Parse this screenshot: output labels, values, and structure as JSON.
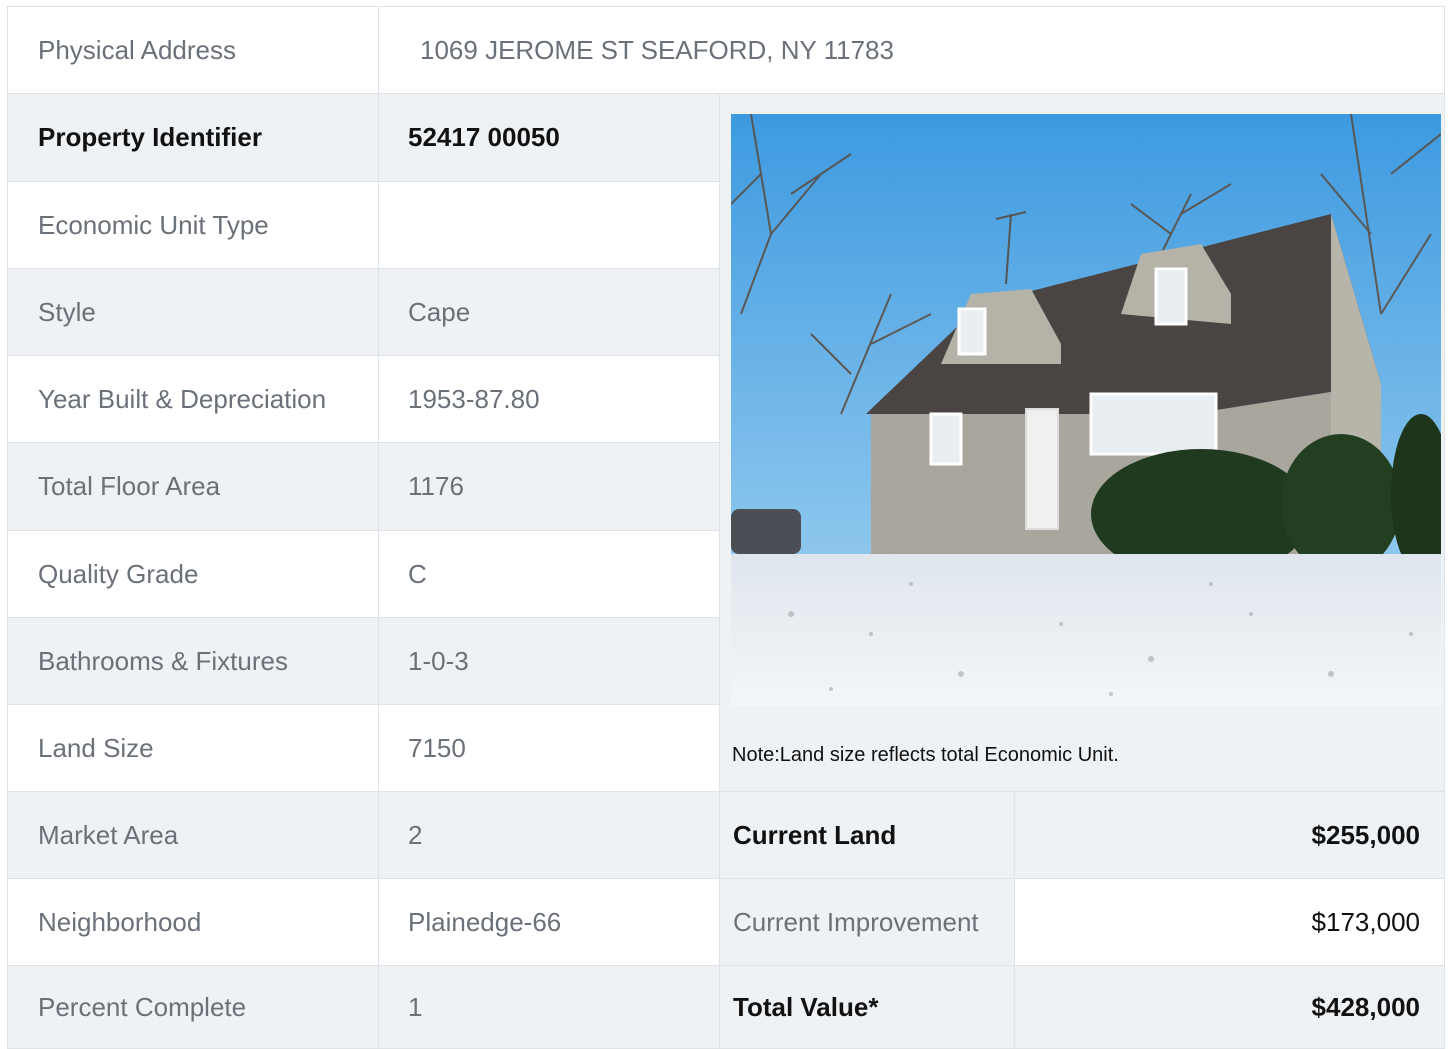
{
  "address": {
    "label": "Physical Address",
    "value": "1069  JEROME ST  SEAFORD, NY  11783"
  },
  "details": [
    {
      "label": "Property Identifier",
      "value": "52417  00050"
    },
    {
      "label": "Economic Unit Type",
      "value": ""
    },
    {
      "label": "Style",
      "value": "Cape"
    },
    {
      "label": "Year Built & Depreciation",
      "value": "1953-87.80"
    },
    {
      "label": "Total Floor Area",
      "value": "1176"
    },
    {
      "label": "Quality Grade",
      "value": "C"
    },
    {
      "label": "Bathrooms & Fixtures",
      "value": "1-0-3"
    },
    {
      "label": "Land Size",
      "value": "7150"
    },
    {
      "label": "Market Area",
      "value": "2"
    },
    {
      "label": "Neighborhood",
      "value": "Plainedge-66"
    },
    {
      "label": "Percent Complete",
      "value": "1"
    }
  ],
  "note": "Note:Land size reflects total Economic Unit.",
  "values": [
    {
      "label": "Current Land",
      "value": "$255,000"
    },
    {
      "label": "Current Improvement",
      "value": "$173,000"
    },
    {
      "label": "Total Value*",
      "value": "$428,000"
    }
  ],
  "colors": {
    "row_shade": "#eff2f5",
    "border": "#dfe3e8",
    "muted_text": "#6b7178",
    "strong_text": "#111111"
  }
}
